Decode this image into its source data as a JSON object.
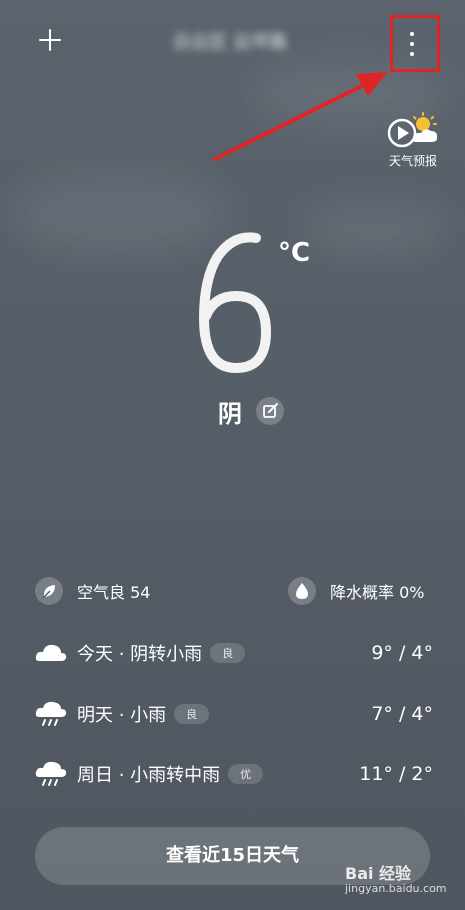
{
  "header": {
    "location": "白云区 云坪路",
    "add_icon": "plus-icon",
    "more_icon": "more-vertical-icon"
  },
  "forecast_video": {
    "label": "天气预报",
    "icon": "play-sun-cloud-icon"
  },
  "current": {
    "temperature": "6",
    "unit": "°C",
    "condition": "阴"
  },
  "metrics": {
    "air_quality": "空气良 54",
    "precip_probability": "降水概率 0%"
  },
  "days": [
    {
      "label": "今天 · 阴转小雨",
      "badge": "良",
      "hilo": "9° / 4°",
      "icon": "cloud-icon"
    },
    {
      "label": "明天 · 小雨",
      "badge": "良",
      "hilo": "7° / 4°",
      "icon": "rain-cloud-icon"
    },
    {
      "label": "周日 · 小雨转中雨",
      "badge": "优",
      "hilo": "11° / 2°",
      "icon": "rain-cloud-icon"
    }
  ],
  "bottom_button": "查看近15日天气",
  "watermark": {
    "line1": "Bai 经验",
    "line2": "jingyan.baidu.com"
  },
  "colors": {
    "highlight": "#e02424",
    "background": "#555d67"
  }
}
